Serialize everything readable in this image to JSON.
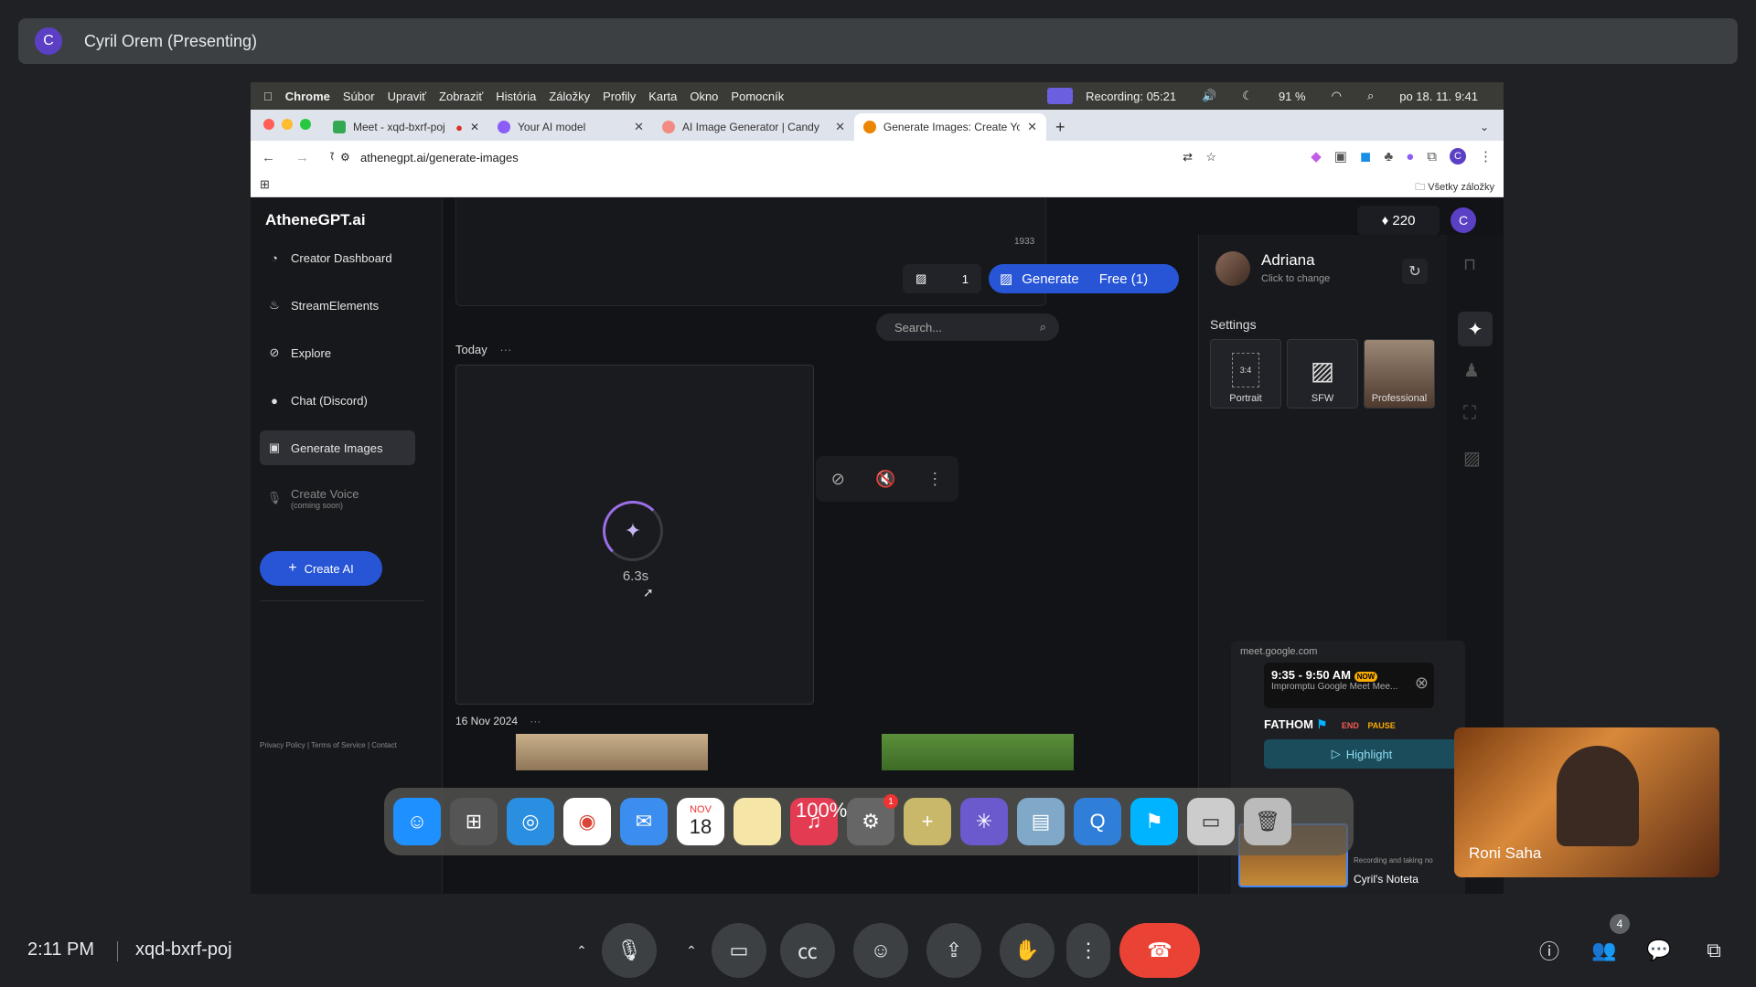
{
  "meet": {
    "presenter_initial": "C",
    "presenter_label": "Cyril Orem (Presenting)",
    "time": "2:11 PM",
    "meeting_code": "xqd-bxrf-poj",
    "participant_count": "4",
    "tile_name": "Roni Saha"
  },
  "mac_menubar": {
    "items": [
      "Chrome",
      "Súbor",
      "Upraviť",
      "Zobraziť",
      "História",
      "Záložky",
      "Profily",
      "Karta",
      "Okno",
      "Pomocník"
    ],
    "recording": "Recording: 05:21",
    "battery": "91 %",
    "datetime": "po 18. 11.  9:41"
  },
  "browser": {
    "tabs": [
      {
        "title": "Meet - xqd-bxrf-poj",
        "color": "#34a853"
      },
      {
        "title": "Your AI model",
        "color": "#8b5cf6"
      },
      {
        "title": "AI Image Generator | Candy.A",
        "color": "#f28b82"
      },
      {
        "title": "Generate Images: Create You",
        "color": "#ea8600"
      }
    ],
    "url": "athenegpt.ai/generate-images",
    "all_bookmarks": "Všetky záložky"
  },
  "app": {
    "brand": "AtheneGPT.ai",
    "credits": "♦ 220",
    "user_initial": "C",
    "nav": [
      {
        "label": "Creator Dashboard",
        "icon": "◔"
      },
      {
        "label": "StreamElements",
        "icon": "♨"
      },
      {
        "label": "Explore",
        "icon": "⊘"
      },
      {
        "label": "Chat (Discord)",
        "icon": "●"
      },
      {
        "label": "Generate Images",
        "icon": "▣"
      }
    ],
    "create_voice": "Create Voice",
    "coming_soon": "(coming soon)",
    "create_ai": "Create AI",
    "footer": "Privacy Policy | Terms of Service | Contact",
    "char_count": "1933",
    "image_count": "1",
    "generate_label": "Generate",
    "free_label": "Free (1)",
    "search_placeholder": "Search...",
    "today_label": "Today",
    "ellipsis": "···",
    "timer": "6.3s",
    "date_label": "16 Nov 2024",
    "character": {
      "name": "Adriana",
      "hint": "Click to change"
    },
    "settings_label": "Settings",
    "options": [
      {
        "label": "Portrait",
        "sub": "3:4"
      },
      {
        "label": "SFW"
      },
      {
        "label": "Professional"
      }
    ]
  },
  "fathom": {
    "domain": "meet.google.com",
    "time_range": "9:35 - 9:50 AM",
    "now_badge": "NOW",
    "meeting_title": "Impromptu Google Meet Mee...",
    "brand": "FATHOM",
    "end": "END",
    "pause": "PAUSE",
    "highlight": "Highlight",
    "recording_hint": "Recording and taking no",
    "notetaker": "Cyril's Noteta"
  },
  "dock": {
    "calendar_month": "NOV",
    "calendar_day": "18",
    "volume_overlay": "100%",
    "notification_badge": "1"
  }
}
